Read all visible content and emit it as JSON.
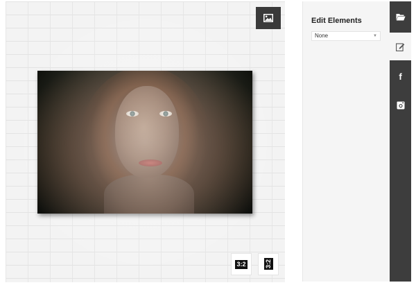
{
  "canvas": {
    "image_button_icon": "image-icon",
    "ratio_buttons": [
      {
        "label": "3:2",
        "orientation": "landscape"
      },
      {
        "label": "3:2",
        "orientation": "portrait"
      }
    ]
  },
  "panel": {
    "title": "Edit Elements",
    "select": {
      "value": "None"
    }
  },
  "toolbar": {
    "items": [
      {
        "icon": "folder-open-icon",
        "active": false
      },
      {
        "icon": "edit-icon",
        "active": true
      },
      {
        "icon": "facebook-icon",
        "glyph": "f",
        "active": false
      },
      {
        "icon": "instagram-icon",
        "active": false
      }
    ]
  },
  "colors": {
    "toolbar_bg": "#3d3d3d",
    "panel_bg": "#f5f5f5",
    "wall_bg": "#f3f3f3"
  }
}
